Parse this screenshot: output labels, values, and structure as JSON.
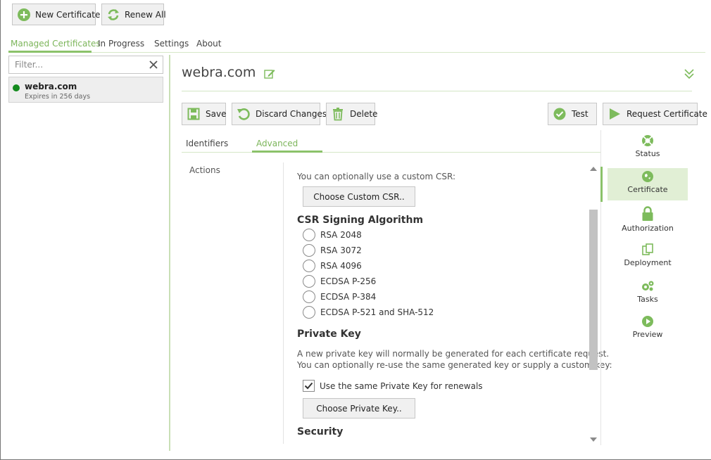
{
  "toolbar": {
    "new_certificate": "New Certificate",
    "renew_all": "Renew All"
  },
  "nav_tabs": {
    "managed": "Managed Certificates",
    "in_progress": "In Progress",
    "settings": "Settings",
    "about": "About"
  },
  "filter": {
    "placeholder": "Filter..."
  },
  "certificates": [
    {
      "name": "webra.com",
      "expires": "Expires in 256 days",
      "status_color": "#138a1d"
    }
  ],
  "detail": {
    "title": "webra.com",
    "buttons": {
      "save": "Save",
      "discard": "Discard Changes",
      "delete": "Delete",
      "test": "Test",
      "request": "Request Certificate"
    },
    "subtabs": {
      "identifiers": "Identifiers",
      "advanced": "Advanced"
    },
    "actions_label": "Actions",
    "csr_text": "You can optionally use a custom CSR:",
    "choose_csr": "Choose Custom CSR..",
    "csr_heading": "CSR Signing Algorithm",
    "algorithms": [
      "RSA 2048",
      "RSA 3072",
      "RSA 4096",
      "ECDSA P-256",
      "ECDSA P-384",
      "ECDSA P-521 and SHA-512"
    ],
    "private_key_heading": "Private Key",
    "private_key_text1": "A new private key will normally be generated for each certificate request.",
    "private_key_text2": "You can optionally re-use the same generated key or supply a custom key:",
    "reuse_key_label": "Use the same Private Key for renewals",
    "reuse_key_checked": true,
    "choose_private_key": "Choose Private Key..",
    "security_heading": "Security"
  },
  "side_nav": {
    "status": "Status",
    "certificate": "Certificate",
    "authorization": "Authorization",
    "deployment": "Deployment",
    "tasks": "Tasks",
    "preview": "Preview"
  },
  "colors": {
    "accent": "#8bc26a",
    "icon_green": "#7dbb5c",
    "status_green": "#138a1d"
  }
}
